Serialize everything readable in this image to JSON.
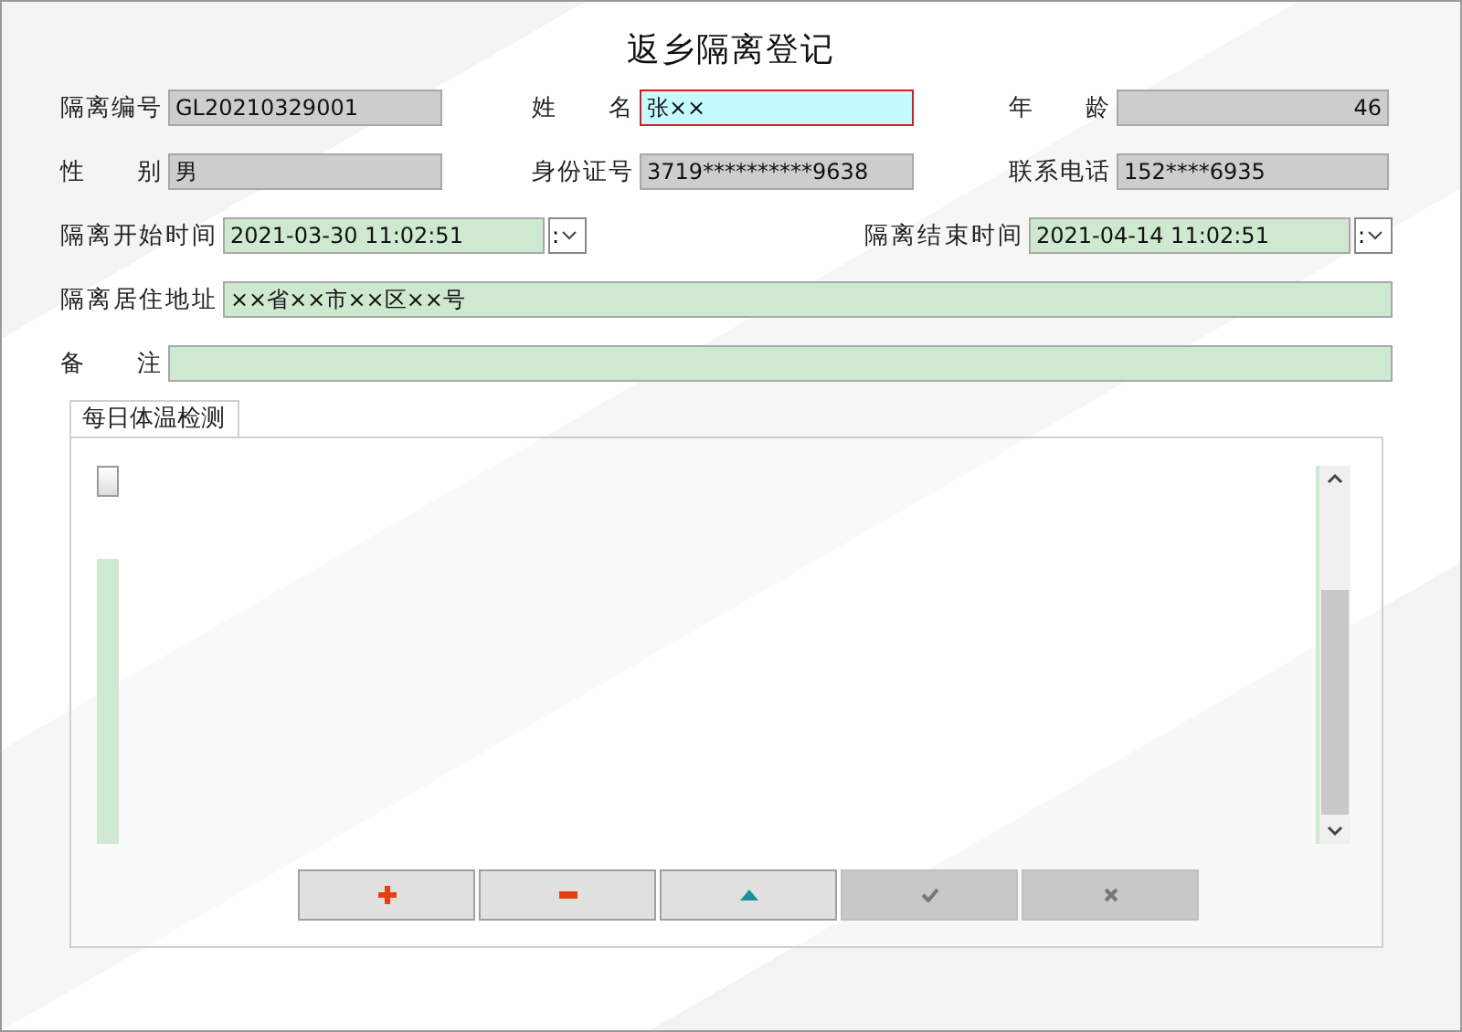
{
  "window": {
    "title": "返乡隔离登记"
  },
  "rows": [
    [
      {
        "label": "隔离编号",
        "value": "GL20210329001",
        "kind": "readonly",
        "focused": false
      },
      {
        "label": "姓 名",
        "value": "张××",
        "kind": "editable-plain",
        "focused": true
      },
      {
        "label": "年 龄",
        "value": "46",
        "kind": "readonly-number",
        "focused": false
      }
    ],
    [
      {
        "label": "性 别",
        "value": "男",
        "kind": "readonly",
        "focused": false
      },
      {
        "label": "身份证号",
        "value": "3719**********9638",
        "kind": "readonly",
        "focused": false
      },
      {
        "label": "联系电话",
        "value": "152****6935",
        "kind": "readonly",
        "focused": false
      }
    ],
    [
      {
        "label": "隔离开始时间",
        "value": "2021-03-30 11:02:51",
        "kind": "datetime",
        "picker_text": ":",
        "focused": false
      },
      {
        "label": "隔离结束时间",
        "value": "2021-04-14 11:02:51",
        "kind": "datetime",
        "picker_text": ":",
        "focused": false
      }
    ],
    [
      {
        "label": "隔离居住地址",
        "value": "××省××市××区××号",
        "kind": "editable",
        "focused": false
      }
    ],
    [
      {
        "label": "备 注",
        "kind": "editable",
        "focused": false
      }
    ]
  ],
  "tab_panel": {
    "tabs": [
      {
        "label": "每日体温检测",
        "selected": true
      }
    ],
    "toolbar": [
      {
        "kind": "add",
        "disabled": false
      },
      {
        "kind": "remove",
        "disabled": false
      },
      {
        "kind": "up",
        "disabled": false
      },
      {
        "kind": "confirm",
        "disabled": true
      },
      {
        "kind": "cancel",
        "disabled": true
      }
    ]
  }
}
